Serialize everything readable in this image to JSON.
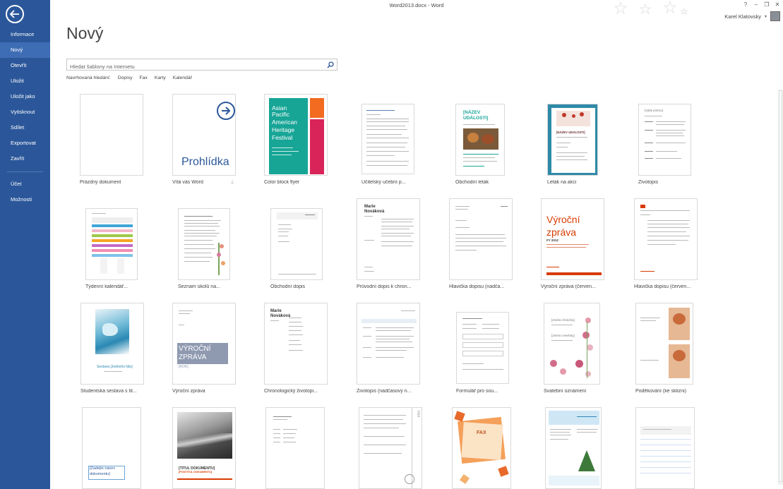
{
  "window": {
    "title": "Word2013.docx - Word"
  },
  "controls": {
    "help": "?",
    "minimize": "–",
    "restore": "❐",
    "close": "✕"
  },
  "user": {
    "name": "Karel Klatovsky"
  },
  "sidebar": {
    "items": [
      {
        "label": "Informace"
      },
      {
        "label": "Nový",
        "active": true
      },
      {
        "label": "Otevřít"
      },
      {
        "label": "Uložit"
      },
      {
        "label": "Uložit jako"
      },
      {
        "label": "Vytisknout"
      },
      {
        "label": "Sdílet"
      },
      {
        "label": "Exportovat"
      },
      {
        "label": "Zavřít"
      },
      {
        "label": "Účet"
      },
      {
        "label": "Možnosti"
      }
    ]
  },
  "main": {
    "title": "Nový",
    "search": {
      "placeholder": "Hledat šablony na Internetu"
    },
    "suggested": {
      "label": "Navrhovaná hledání:",
      "links": [
        "Dopisy",
        "Fax",
        "Karty",
        "Kalendář"
      ]
    }
  },
  "templates": [
    {
      "label": "Prázdný dokument"
    },
    {
      "label": "Vítá vás Word",
      "preview_text": "Prohlídka"
    },
    {
      "label": "Color block flyer",
      "preview_text": [
        "Asian",
        "Pacific",
        "American",
        "Heritage",
        "Festival"
      ]
    },
    {
      "label": "Učitelský učební p..."
    },
    {
      "label": "Obchodní leták",
      "preview_text": [
        "[NÁZEV",
        "UDÁLOSTI]"
      ]
    },
    {
      "label": "Leták na akci",
      "preview_text": [
        "[NÁZEV UDÁLOSTI]"
      ]
    },
    {
      "label": "Životopis",
      "preview_text": "[Vaše jméno]"
    },
    {
      "label": "Týdenní kalendář..."
    },
    {
      "label": "Seznam úkolů na..."
    },
    {
      "label": "Obchodní dopis"
    },
    {
      "label": "Průvodní dopis k chron...",
      "preview_text": [
        "Marie",
        "Nováková"
      ]
    },
    {
      "label": "Hlavička dopisu (nadča..."
    },
    {
      "label": "Výroční zpráva (červen...",
      "preview_text": [
        "Výroční",
        "zpráva",
        "FY 2012"
      ]
    },
    {
      "label": "Hlavička dopisu (červen..."
    },
    {
      "label": "Studentská sestava s tit...",
      "preview_text": "Sestava [Jednoho lidu]"
    },
    {
      "label": "Výroční zpráva",
      "preview_text": [
        "VÝROČNÍ",
        "ZPRÁVA",
        "[ROK]"
      ]
    },
    {
      "label": "Chronologický životopi...",
      "preview_text": [
        "Marie",
        "Nováková"
      ]
    },
    {
      "label": "Životopis (nadčasový n..."
    },
    {
      "label": "Formulář pro sou..."
    },
    {
      "label": "Svatební oznámení",
      "preview_text": [
        "[Jméno ženicha]",
        "[Jméno nevěsty]"
      ]
    },
    {
      "label": "Poděkování (ke sklizni)"
    },
    {
      "label": "",
      "preview_text": [
        "[Zadejte název",
        "dokumentu]"
      ]
    },
    {
      "label": "",
      "preview_text": [
        "[TITUL DOKUMENTU]",
        "[PODTITUL DOKUMENTU]"
      ]
    },
    {
      "label": ""
    },
    {
      "label": "",
      "preview_text": "FAX"
    },
    {
      "label": "",
      "preview_text": "FAX"
    },
    {
      "label": ""
    },
    {
      "label": ""
    }
  ],
  "colors": {
    "sidebar": "#2b579a",
    "sidebar_active": "#3e6db5",
    "accent_teal": "#17a596",
    "accent_red": "#d83b01"
  }
}
